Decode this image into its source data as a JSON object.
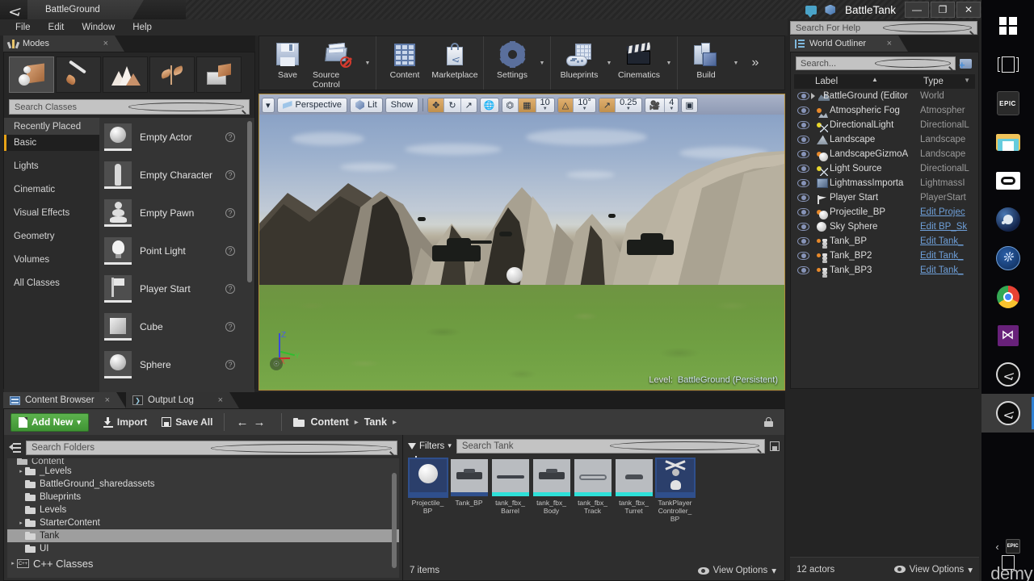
{
  "titlebar": {
    "project_tab": "BattleGround",
    "app_name": "BattleTank",
    "minimize": "—",
    "maximize": "❐",
    "close": "✕",
    "icons": [
      "speech-bubble-icon",
      "cube-icon"
    ]
  },
  "menubar": {
    "items": [
      "File",
      "Edit",
      "Window",
      "Help"
    ]
  },
  "help_search": {
    "placeholder": "Search For Help",
    "icon": "search-icon"
  },
  "modes": {
    "tab_label": "Modes",
    "close": "×",
    "mode_buttons": [
      "place-mode",
      "paint-mode",
      "landscape-mode",
      "foliage-mode",
      "geometry-edit-mode"
    ],
    "search_placeholder": "Search Classes",
    "categories": [
      {
        "label": "Recently Placed",
        "selected": false
      },
      {
        "label": "Basic",
        "selected": true
      },
      {
        "label": "Lights",
        "selected": false
      },
      {
        "label": "Cinematic",
        "selected": false
      },
      {
        "label": "Visual Effects",
        "selected": false
      },
      {
        "label": "Geometry",
        "selected": false
      },
      {
        "label": "Volumes",
        "selected": false
      },
      {
        "label": "All Classes",
        "selected": false
      }
    ],
    "items": [
      {
        "label": "Empty Actor",
        "thumb": "sphere"
      },
      {
        "label": "Empty Character",
        "thumb": "character"
      },
      {
        "label": "Empty Pawn",
        "thumb": "pawn"
      },
      {
        "label": "Point Light",
        "thumb": "bulb"
      },
      {
        "label": "Player Start",
        "thumb": "flag"
      },
      {
        "label": "Cube",
        "thumb": "cube"
      },
      {
        "label": "Sphere",
        "thumb": "sphere"
      }
    ],
    "help_glyph": "?"
  },
  "main_toolbar": {
    "items": [
      {
        "label": "Save",
        "icon": "save-icon",
        "dropdown": false
      },
      {
        "label": "Source Control",
        "icon": "source-control-icon",
        "dropdown": true
      },
      {
        "label": "Content",
        "icon": "content-icon",
        "dropdown": false
      },
      {
        "label": "Marketplace",
        "icon": "marketplace-icon",
        "dropdown": false
      },
      {
        "label": "Settings",
        "icon": "settings-gear-icon",
        "dropdown": true
      },
      {
        "label": "Blueprints",
        "icon": "blueprints-icon",
        "dropdown": true
      },
      {
        "label": "Cinematics",
        "icon": "cinematics-clapper-icon",
        "dropdown": true
      },
      {
        "label": "Build",
        "icon": "build-icon",
        "dropdown": true
      }
    ],
    "overflow": "»"
  },
  "viewport": {
    "toolbar": {
      "menu_arrow": "▾",
      "perspective": "Perspective",
      "lit": "Lit",
      "show": "Show",
      "transform_modes": [
        "move-tool",
        "rotate-tool",
        "scale-tool"
      ],
      "coord_system": "world-coordinate-icon",
      "surface_snap": "surface-snap-icon",
      "grid_snap_enabled": true,
      "grid_snap_value": "10",
      "angle_snap_value": "10°",
      "scale_snap_value": "0.25",
      "camera_speed": "4",
      "maximize_icon": "maximize-viewport-icon"
    },
    "level_prefix": "Level:",
    "level_name": "BattleGround (Persistent)",
    "axis": {
      "z": "Z",
      "x": "X",
      "y": "Y"
    }
  },
  "world_outliner": {
    "tab_label": "World Outliner",
    "close": "×",
    "search_placeholder": "Search...",
    "add_folder_icon": "add-folder-icon",
    "columns": {
      "label": "Label",
      "type": "Type"
    },
    "rows": [
      {
        "label": "BattleGround (Editor",
        "type": "World",
        "icon": "world-icon",
        "indent": 0,
        "expander": true,
        "link": false
      },
      {
        "label": "Atmospheric Fog",
        "type": "Atmospher",
        "icon": "fog-icon",
        "indent": 1,
        "expander": false,
        "link": false
      },
      {
        "label": "DirectionalLight",
        "type": "DirectionalL",
        "icon": "directional-light-icon",
        "indent": 1,
        "expander": false,
        "link": false
      },
      {
        "label": "Landscape",
        "type": "Landscape",
        "icon": "landscape-icon",
        "indent": 1,
        "expander": false,
        "link": false
      },
      {
        "label": "LandscapeGizmoA",
        "type": "Landscape",
        "icon": "landscape-gizmo-icon",
        "indent": 1,
        "expander": false,
        "link": false
      },
      {
        "label": "Light Source",
        "type": "DirectionalL",
        "icon": "directional-light-icon",
        "indent": 1,
        "expander": false,
        "link": false
      },
      {
        "label": "LightmassImporta",
        "type": "LightmassI",
        "icon": "lightmass-icon",
        "indent": 1,
        "expander": false,
        "link": false
      },
      {
        "label": "Player Start",
        "type": "PlayerStart",
        "icon": "player-start-icon",
        "indent": 1,
        "expander": false,
        "link": false
      },
      {
        "label": "Projectile_BP",
        "type": "Edit Projec",
        "icon": "blueprint-sphere-icon",
        "indent": 1,
        "expander": false,
        "link": true
      },
      {
        "label": "Sky Sphere",
        "type": "Edit BP_Sk",
        "icon": "sphere-icon",
        "indent": 1,
        "expander": false,
        "link": true
      },
      {
        "label": "Tank_BP",
        "type": "Edit Tank_",
        "icon": "tank-blueprint-icon",
        "indent": 1,
        "expander": false,
        "link": true
      },
      {
        "label": "Tank_BP2",
        "type": "Edit Tank_",
        "icon": "tank-blueprint-icon",
        "indent": 1,
        "expander": false,
        "link": true
      },
      {
        "label": "Tank_BP3",
        "type": "Edit Tank_",
        "icon": "tank-blueprint-icon",
        "indent": 1,
        "expander": false,
        "link": true
      }
    ],
    "actor_count": "12 actors",
    "view_options": "View Options",
    "view_options_arrow": "▾"
  },
  "content_browser": {
    "tabs": [
      {
        "label": "Content Browser",
        "active": true,
        "close": "×",
        "icon": "content-browser-icon"
      },
      {
        "label": "Output Log",
        "active": false,
        "close": "×",
        "icon": "output-log-icon"
      }
    ],
    "add_new": "Add New",
    "add_new_arrow": "▾",
    "import": "Import",
    "save_all": "Save All",
    "nav_back": "←",
    "nav_forward": "→",
    "breadcrumb": [
      "Content",
      "Tank"
    ],
    "breadcrumb_sep": "▸",
    "lock_icon": "lock-icon",
    "folder_search_placeholder": "Search Folders",
    "folder_tree": [
      {
        "label": "Content",
        "indent": 0,
        "arrow": "",
        "selected": false,
        "clipped": true,
        "type": "folder"
      },
      {
        "label": "_Levels",
        "indent": 1,
        "arrow": "▸",
        "selected": false,
        "type": "folder"
      },
      {
        "label": "BattleGround_sharedassets",
        "indent": 1,
        "arrow": "",
        "selected": false,
        "type": "folder"
      },
      {
        "label": "Blueprints",
        "indent": 1,
        "arrow": "",
        "selected": false,
        "type": "folder"
      },
      {
        "label": "Levels",
        "indent": 1,
        "arrow": "",
        "selected": false,
        "type": "folder"
      },
      {
        "label": "StarterContent",
        "indent": 1,
        "arrow": "▸",
        "selected": false,
        "type": "folder"
      },
      {
        "label": "Tank",
        "indent": 1,
        "arrow": "",
        "selected": true,
        "type": "folder"
      },
      {
        "label": "UI",
        "indent": 1,
        "arrow": "",
        "selected": false,
        "type": "folder"
      },
      {
        "label": "C++ Classes",
        "indent": 0,
        "arrow": "▸",
        "selected": false,
        "type": "cpp"
      }
    ],
    "filters_label": "Filters",
    "filters_arrow": "▾",
    "asset_search_placeholder": "Search Tank",
    "assets": [
      {
        "name": "Projectile_\nBP",
        "thumb": "sphere",
        "selected": true,
        "bar": "#2f4f8c"
      },
      {
        "name": "Tank_BP",
        "thumb": "tank",
        "selected": false,
        "bar": "#2f4f8c"
      },
      {
        "name": "tank_fbx_\nBarrel",
        "thumb": "barrel",
        "selected": false,
        "bar": "#2ee0d8"
      },
      {
        "name": "tank_fbx_\nBody",
        "thumb": "body",
        "selected": false,
        "bar": "#2ee0d8"
      },
      {
        "name": "tank_fbx_\nTrack",
        "thumb": "track",
        "selected": false,
        "bar": "#2ee0d8"
      },
      {
        "name": "tank_fbx_\nTurret",
        "thumb": "turret",
        "selected": false,
        "bar": "#2ee0d8"
      },
      {
        "name": "TankPlayer\nController_\nBP",
        "thumb": "controller",
        "selected": true,
        "bar": "#2f4f8c"
      }
    ],
    "item_count": "7 items",
    "view_options": "View Options",
    "view_options_arrow": "▾"
  },
  "taskbar": {
    "icons": [
      "windows-start-icon",
      "task-view-icon",
      "epic-games-icon",
      "file-explorer-icon",
      "oculus-icon",
      "steam-icon",
      "pcoip-icon",
      "chrome-icon",
      "visual-studio-icon",
      "unreal-engine-icon",
      "unreal-editor-icon"
    ],
    "tray_chevron": "‹",
    "tray_epic": "EPIC",
    "watermark": "demy"
  },
  "colors": {
    "accent_orange": "#e8a317",
    "add_new_green": "#4ba33e",
    "link_blue": "#6e9fd8",
    "viewport_border": "#b08c3a",
    "panel_bg": "#2b2b2b"
  }
}
